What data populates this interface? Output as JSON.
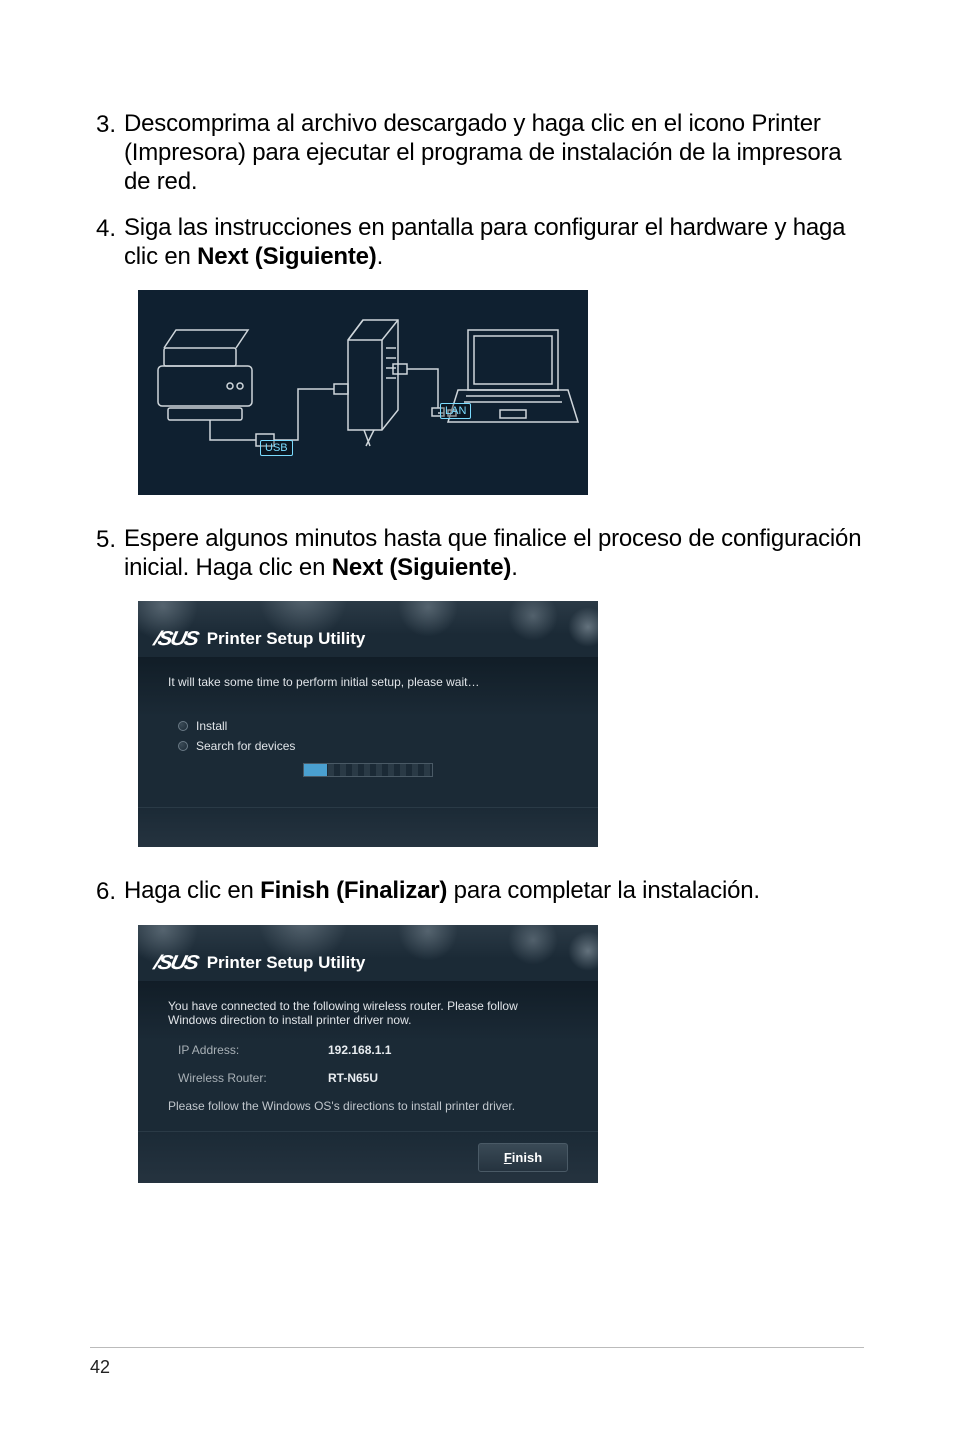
{
  "items": [
    {
      "num": "3.",
      "html": "Descomprima al archivo descargado y haga clic en el icono Printer (Impresora) para ejecutar el programa de instalación de la impresora de red."
    },
    {
      "num": "4.",
      "html": "Siga las instrucciones en pantalla para configurar el hardware y haga clic en <b>Next (Siguiente)</b>."
    },
    {
      "num": "5.",
      "html": "Espere algunos minutos hasta que finalice el proceso de configuración inicial. Haga clic en <b>Next (Siguiente)</b>."
    },
    {
      "num": "6.",
      "html": "Haga clic en <b>Finish (Finalizar)</b> para completar la instalación."
    }
  ],
  "fig1": {
    "usb_label": "USB",
    "lan_label": "LAN"
  },
  "psu": {
    "brand": "/SUS",
    "title": "Printer Setup Utility"
  },
  "fig2": {
    "msg": "It will take some time to perform initial setup, please wait…",
    "opt1": "Install",
    "opt2": "Search for devices"
  },
  "fig3": {
    "msg": "You have connected to the following wireless router. Please follow Windows direction to install printer driver now.",
    "ip_label": "IP Address:",
    "ip_value": "192.168.1.1",
    "router_label": "Wireless Router:",
    "router_value": "RT-N65U",
    "note": "Please follow the Windows OS's directions to install printer driver.",
    "finish_btn_pre": "F",
    "finish_btn_rest": "inish"
  },
  "page_number": "42"
}
